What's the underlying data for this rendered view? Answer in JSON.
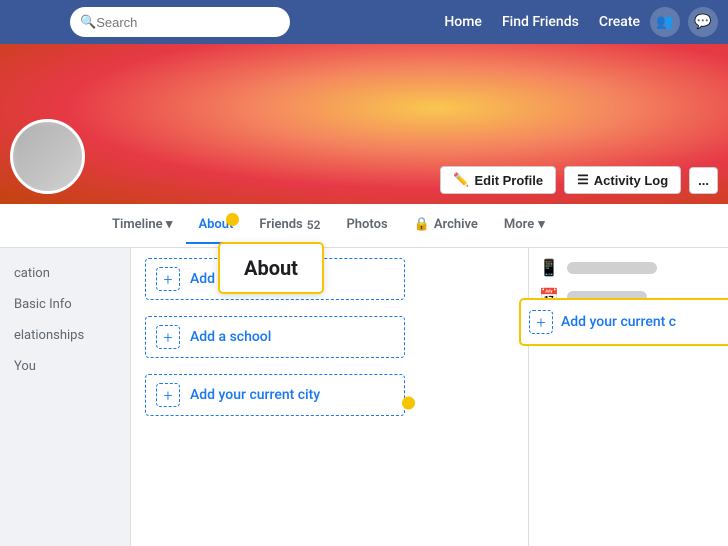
{
  "nav": {
    "home": "Home",
    "find_friends": "Find Friends",
    "create": "Create",
    "search_placeholder": "Search"
  },
  "profile": {
    "edit_profile": "Edit Profile",
    "activity_log": "Activity Log",
    "more_dots": "..."
  },
  "tabs": [
    {
      "label": "Timeline",
      "has_arrow": true
    },
    {
      "label": "About",
      "active": true
    },
    {
      "label": "Friends",
      "badge": "52"
    },
    {
      "label": "Photos"
    },
    {
      "label": "Archive",
      "has_lock": true
    },
    {
      "label": "More",
      "has_arrow": true
    }
  ],
  "sidebar": [
    {
      "label": "cation",
      "id": "location"
    },
    {
      "label": "Basic Info",
      "id": "basic-info"
    },
    {
      "label": "elationships",
      "id": "relationships"
    },
    {
      "label": "You",
      "id": "you"
    }
  ],
  "about_tooltip": {
    "text": "About"
  },
  "add_items": [
    {
      "label": "Add a workplace",
      "id": "workplace"
    },
    {
      "label": "Add a school",
      "id": "school"
    },
    {
      "label": "Add your current city",
      "id": "city"
    }
  ],
  "city_panel_tooltip": {
    "text": "Add your current c"
  }
}
